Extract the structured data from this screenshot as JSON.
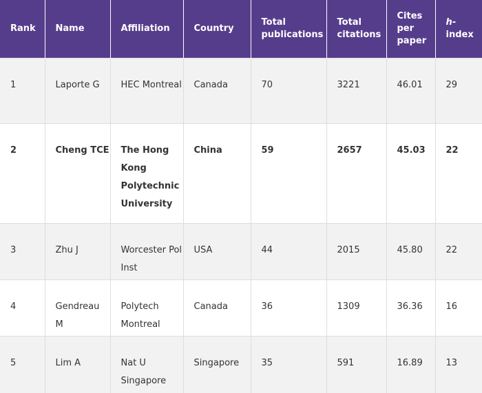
{
  "table": {
    "headers": {
      "rank": "Rank",
      "name": "Name",
      "affiliation": "Affiliation",
      "country": "Country",
      "total_publications": "Total publications",
      "total_citations": "Total citations",
      "cites_per_paper": "Cites per paper",
      "h_index_italic": "h",
      "h_index_rest": "-index"
    },
    "rows": [
      {
        "rank": "1",
        "name": "Laporte G",
        "affiliation": "HEC Montreal",
        "country": "Canada",
        "total_publications": "70",
        "total_citations": "3221",
        "cites_per_paper": "46.01",
        "h_index": "29"
      },
      {
        "rank": "2",
        "name": "Cheng TCE",
        "affiliation": "The Hong Kong Polytechnic University",
        "country": "China",
        "total_publications": "59",
        "total_citations": "2657",
        "cites_per_paper": "45.03",
        "h_index": "22"
      },
      {
        "rank": "3",
        "name": "Zhu J",
        "affiliation": "Worcester Pol Inst",
        "country": "USA",
        "total_publications": "44",
        "total_citations": "2015",
        "cites_per_paper": "45.80",
        "h_index": "22"
      },
      {
        "rank": "4",
        "name": "Gendreau M",
        "affiliation": "Polytech Montreal",
        "country": "Canada",
        "total_publications": "36",
        "total_citations": "1309",
        "cites_per_paper": "36.36",
        "h_index": "16"
      },
      {
        "rank": "5",
        "name": "Lim A",
        "affiliation": "Nat U Singapore",
        "country": "Singapore",
        "total_publications": "35",
        "total_citations": "591",
        "cites_per_paper": "16.89",
        "h_index": "13"
      }
    ]
  },
  "colors": {
    "header_bg": "#563d8c",
    "header_text": "#ffffff",
    "row_odd_bg": "#f2f2f2",
    "row_even_bg": "#ffffff",
    "border": "#dddddd"
  }
}
